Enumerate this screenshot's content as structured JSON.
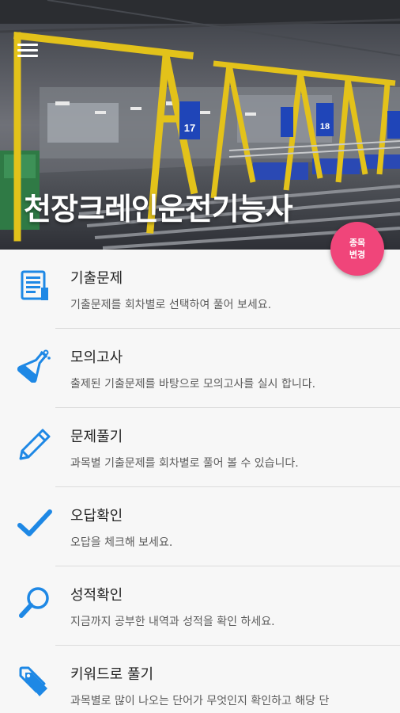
{
  "header": {
    "title": "천장크레인운전기능사",
    "bay_numbers": [
      "17",
      "18"
    ]
  },
  "fab": {
    "line1": "종목",
    "line2": "변경"
  },
  "menu": [
    {
      "title": "기출문제",
      "desc": "기출문제를 회차별로 선택하여 풀어 보세요.",
      "icon": "document-icon"
    },
    {
      "title": "모의고사",
      "desc": "출제된 기출문제를 바탕으로 모의고사를 실시 합니다.",
      "icon": "flask-icon"
    },
    {
      "title": "문제풀기",
      "desc": "과목별 기출문제를 회차별로 풀어 볼 수 있습니다.",
      "icon": "pencil-icon"
    },
    {
      "title": "오답확인",
      "desc": "오답을 체크해 보세요.",
      "icon": "checkmark-icon"
    },
    {
      "title": "성적확인",
      "desc": "지금까지 공부한 내역과 성적을 확인 하세요.",
      "icon": "magnifier-icon"
    },
    {
      "title": "키워드로 풀기",
      "desc": "과목별로 많이 나오는 단어가 무엇인지 확인하고 해당 단",
      "icon": "tag-icon"
    }
  ],
  "colors": {
    "accent": "#1e88e5",
    "fab": "#f0457a"
  }
}
